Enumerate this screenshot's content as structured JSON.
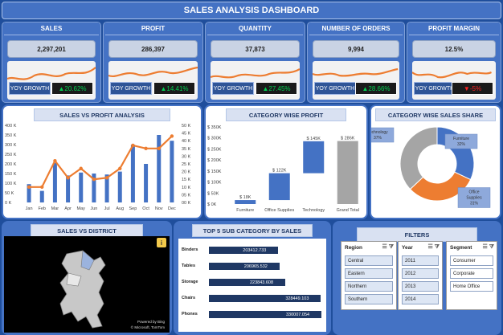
{
  "title": "SALES ANALYSIS DASHBOARD",
  "kpis": [
    {
      "label": "SALES",
      "value": "2,297,201",
      "yoy_label": "YOY GROWTH",
      "yoy_value": "▲20.62%",
      "yoy_color": "#00d050"
    },
    {
      "label": "PROFIT",
      "value": "286,397",
      "yoy_label": "YOY GROWTH",
      "yoy_value": "▲14.41%",
      "yoy_color": "#00d050"
    },
    {
      "label": "QUANTITY",
      "value": "37,873",
      "yoy_label": "YOY GROWTH",
      "yoy_value": "▲27.45%",
      "yoy_color": "#00d050"
    },
    {
      "label": "NUMBER OF ORDERS",
      "value": "9,994",
      "yoy_label": "YOY GROWTH",
      "yoy_value": "▲28.66%",
      "yoy_color": "#00d050"
    },
    {
      "label": "PROFIT MARGIN",
      "value": "12.5%",
      "yoy_label": "YOY GROWTH",
      "yoy_value": "▼-5%",
      "yoy_color": "#ff2020"
    }
  ],
  "panels": {
    "sales_vs_profit": "SALES VS PROFIT ANALYSIS",
    "category_profit": "CATEGORY WISE PROFIT",
    "category_share": "CATEGORY WISE SALES SHARE",
    "sales_district": "SALES VS DISTRICT",
    "top5": "TOP 5 SUB CATEGORY BY SALES",
    "filters": "FILTERS"
  },
  "map": {
    "credit1": "Powered by Bing",
    "credit2": "© Microsoft, TomTom",
    "info": "i"
  },
  "filters": {
    "region": {
      "title": "Region",
      "items": [
        "Central",
        "Eastern",
        "Northern",
        "Southern"
      ]
    },
    "year": {
      "title": "Year",
      "items": [
        "2011",
        "2012",
        "2013",
        "2014"
      ]
    },
    "segment": {
      "title": "Segment",
      "items": [
        "Consumer",
        "Corporate",
        "Home Office"
      ]
    }
  },
  "chart_data": [
    {
      "type": "bar",
      "title": "SALES VS PROFIT ANALYSIS",
      "categories": [
        "Jan",
        "Feb",
        "Mar",
        "Apr",
        "May",
        "Jun",
        "Jul",
        "Aug",
        "Sep",
        "Oct",
        "Nov",
        "Dec"
      ],
      "y_ticks_left": [
        "0 K",
        "50 K",
        "100 K",
        "150 K",
        "200 K",
        "250 K",
        "300 K",
        "350 K",
        "400 K"
      ],
      "y_ticks_right": [
        "00 K",
        "05 K",
        "10 K",
        "15 K",
        "20 K",
        "25 K",
        "30 K",
        "35 K",
        "40 K",
        "45 K",
        "50 K"
      ],
      "ylim": [
        0,
        400
      ],
      "ylim_right": [
        0,
        50
      ],
      "series": [
        {
          "name": "Sales",
          "type": "bar",
          "color": "#4472c4",
          "values": [
            95,
            60,
            205,
            140,
            155,
            150,
            145,
            160,
            300,
            200,
            350,
            320
          ]
        },
        {
          "name": "Profit",
          "type": "line",
          "color": "#ed7d31",
          "values": [
            10,
            10,
            27,
            16,
            22,
            15,
            16,
            22,
            37,
            35,
            35,
            43
          ]
        }
      ]
    },
    {
      "type": "bar",
      "subtype": "waterfall",
      "title": "CATEGORY WISE PROFIT",
      "categories": [
        "Furniture",
        "Office Supplies",
        "Technology",
        "Grand Total"
      ],
      "values": [
        18,
        122,
        145,
        286
      ],
      "data_labels": [
        "$ 18K",
        "$ 122K",
        "$ 145K",
        "$ 286K"
      ],
      "y_ticks": [
        "$ 0K",
        "$ 50K",
        "$ 100K",
        "$ 150K",
        "$ 200K",
        "$ 250K",
        "$ 300K",
        "$ 350K"
      ],
      "ylim": [
        0,
        350
      ]
    },
    {
      "type": "pie",
      "subtype": "donut",
      "title": "CATEGORY WISE SALES SHARE",
      "categories": [
        "Furniture",
        "Office Supplies",
        "Technology"
      ],
      "values": [
        32,
        31,
        37
      ],
      "labels": [
        "Furniture\n32%",
        "Office\nSupplies\n31%",
        "Technology\n37%"
      ],
      "colors": [
        "#4472c4",
        "#ed7d31",
        "#a5a5a5"
      ]
    },
    {
      "type": "bar",
      "orientation": "horizontal",
      "title": "TOP 5 SUB CATEGORY BY SALES",
      "categories": [
        "Binders",
        "Tables",
        "Storage",
        "Chairs",
        "Phones"
      ],
      "values": [
        203412.733,
        206965.532,
        223843.608,
        328449.103,
        330007.054
      ],
      "data_labels": [
        "203412.733",
        "206965.532",
        "223843.608",
        "328449.103",
        "330007.054"
      ]
    }
  ]
}
